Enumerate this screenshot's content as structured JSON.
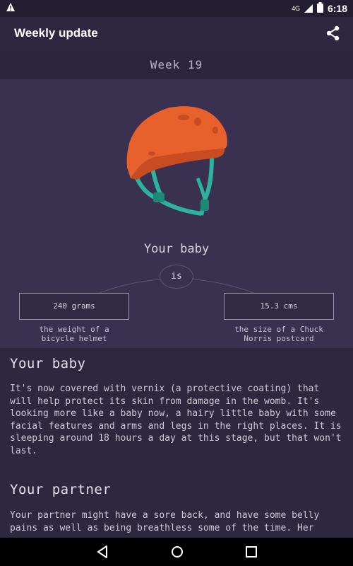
{
  "status_bar": {
    "network": "4G",
    "time": "6:18"
  },
  "app_bar": {
    "title": "Weekly update"
  },
  "week": {
    "label": "Week 19"
  },
  "hero": {
    "heading": "Your baby",
    "connector": "is",
    "weight": {
      "value": "240 grams",
      "caption_line1": "the weight of a",
      "caption_line2": "bicycle helmet"
    },
    "size": {
      "value": "15.3 cms",
      "caption_line1": "the size of a Chuck",
      "caption_line2": "Norris postcard"
    },
    "image_icon": "bicycle-helmet-illustration"
  },
  "sections": [
    {
      "title": "Your baby",
      "body": "It's now covered with vernix (a protective coating) that will help protect its skin from damage in the womb. It's looking more like a baby now, a hairy little baby with some facial features and arms and legs in the right places. It is sleeping around 18 hours a day at this stage, but that won't last."
    },
    {
      "title": "Your partner",
      "body": "Your partner might have a sore back, and have some belly pains as well as being breathless some of the time. Her"
    }
  ],
  "colors": {
    "background": "#2e2740",
    "hero": "#3a3150",
    "helmet": "#e8612c",
    "strap": "#2bb3a0"
  }
}
